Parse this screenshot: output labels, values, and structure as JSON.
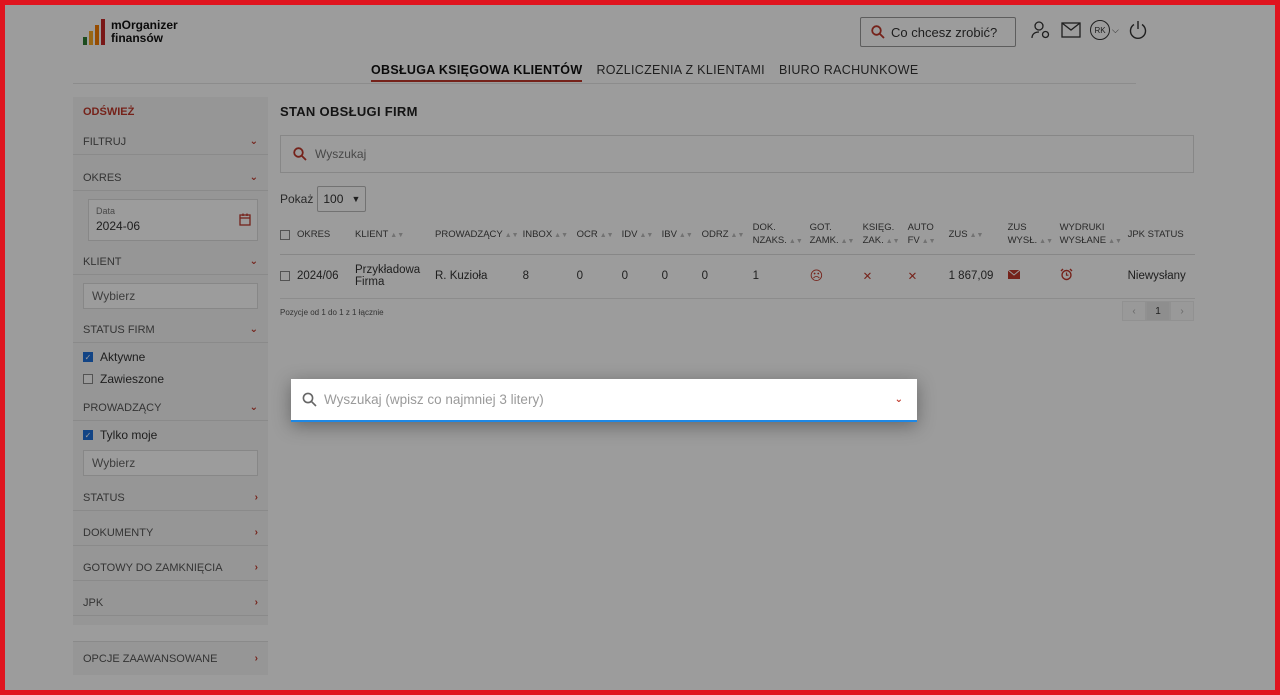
{
  "app": {
    "logo_line1": "mOrganizer",
    "logo_line2": "finansów",
    "logo_colors": [
      "#2e7d32",
      "#f9a825",
      "#f57c00",
      "#c62828"
    ],
    "accent_color": "#c0392b"
  },
  "header": {
    "quick_search_placeholder": "Co chcesz zrobić?",
    "user_initials": "RK",
    "icons": [
      "user-settings-icon",
      "mail-icon",
      "chevron-down-icon",
      "power-icon"
    ]
  },
  "nav": {
    "tabs": [
      {
        "label": "OBSŁUGA KSIĘGOWA KLIENTÓW",
        "active": true
      },
      {
        "label": "ROZLICZENIA Z KLIENTAMI",
        "active": false
      },
      {
        "label": "BIURO RACHUNKOWE",
        "active": false
      }
    ]
  },
  "sidebar": {
    "refresh": "ODŚWIEŻ",
    "filter": "FILTRUJ",
    "period": "OKRES",
    "date_label": "Data",
    "date_value": "2024-06",
    "client": "KLIENT",
    "client_placeholder": "Wybierz",
    "company_status": "STATUS FIRM",
    "active": "Aktywne",
    "suspended": "Zawieszone",
    "lead": "PROWADZĄCY",
    "only_mine": "Tylko moje",
    "lead_placeholder": "Wybierz",
    "status": "STATUS",
    "documents": "DOKUMENTY",
    "ready_to_close": "GOTOWY DO ZAMKNIĘCIA",
    "jpk": "JPK",
    "advanced": "OPCJE ZAAWANSOWANE"
  },
  "content": {
    "title": "STAN OBSŁUGI FIRM",
    "search_placeholder": "Wyszukaj",
    "show_label": "Pokaż",
    "show_value": "100",
    "columns": [
      "OKRES",
      "KLIENT",
      "PROWADZĄCY",
      "INBOX",
      "OCR",
      "IDV",
      "IBV",
      "ODRZ",
      "DOK. NZAKS.",
      "GOT. ZAMK.",
      "KSIĘG. ZAK.",
      "AUTO FV",
      "ZUS",
      "ZUS WYSŁ.",
      "WYDRUKI WYSŁANE",
      "JPK STATUS"
    ],
    "rows": [
      {
        "okres": "2024/06",
        "klient": "Przykładowa Firma",
        "prowadzacy": "R. Kuzioła",
        "inbox": "8",
        "ocr": "0",
        "idv": "0",
        "ibv": "0",
        "odrz": "0",
        "dok_nzaks": "1",
        "zus": "1 867,09",
        "jpk_status": "Niewysłany"
      }
    ],
    "footer_info": "Pozycje od 1 do 1 z 1 łącznie",
    "current_page": "1"
  },
  "modal": {
    "placeholder": "Wyszukaj (wpisz co najmniej 3 litery)"
  }
}
